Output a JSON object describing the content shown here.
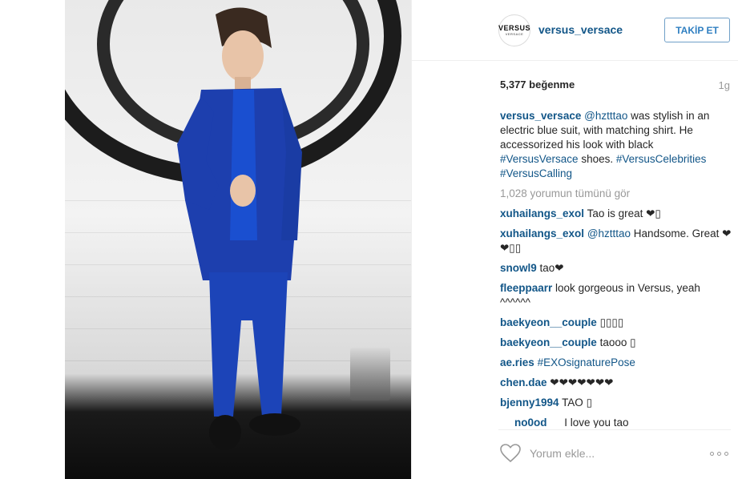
{
  "post": {
    "account": "versus_versace",
    "avatar_logo_main": "VERSUS",
    "avatar_logo_sub": "VERSACE",
    "follow_label": "TAKİP ET",
    "likes": "5,377 beğenme",
    "time": "1g"
  },
  "caption": {
    "user": "versus_versace",
    "mention": "@hztttao",
    "text_1": " was stylish in an electric blue suit, with matching shirt. He accessorized his look with black ",
    "hashtag_1": "#VersusVersace",
    "text_2": " shoes. ",
    "hashtag_2": "#VersusCelebrities",
    "hashtag_3": "#VersusCalling"
  },
  "view_all_comments": "1,028 yorumun tümünü gör",
  "comments": [
    {
      "user": "xuhailangs_exol",
      "text": "Tao is great ❤▯"
    },
    {
      "user": "xuhailangs_exol",
      "mention": "@hztttao",
      "text": " Handsome. Great ❤❤▯▯"
    },
    {
      "user": "snowl9",
      "text": "tao❤"
    },
    {
      "user": "fleeppaarr",
      "text": "look gorgeous in Versus, yeah ^^^^^^"
    },
    {
      "user": "baekyeon__couple",
      "text": "▯▯▯▯"
    },
    {
      "user": "baekyeon__couple",
      "text": "taooo ▯"
    },
    {
      "user": "ae.ries",
      "hashtag": "#EXOsignaturePose"
    },
    {
      "user": "chen.dae",
      "text": "❤❤❤❤❤❤❤"
    },
    {
      "user": "bjenny1994",
      "text": "TAO ▯"
    },
    {
      "user": "no0od",
      "text": "I love you tao"
    }
  ],
  "footer": {
    "comment_placeholder": "Yorum ekle...",
    "like_icon": "heart-outline-icon",
    "more_icon": "more-options-icon"
  },
  "colors": {
    "link": "#125688",
    "follow_border": "#70a0c8",
    "muted": "#999999"
  }
}
